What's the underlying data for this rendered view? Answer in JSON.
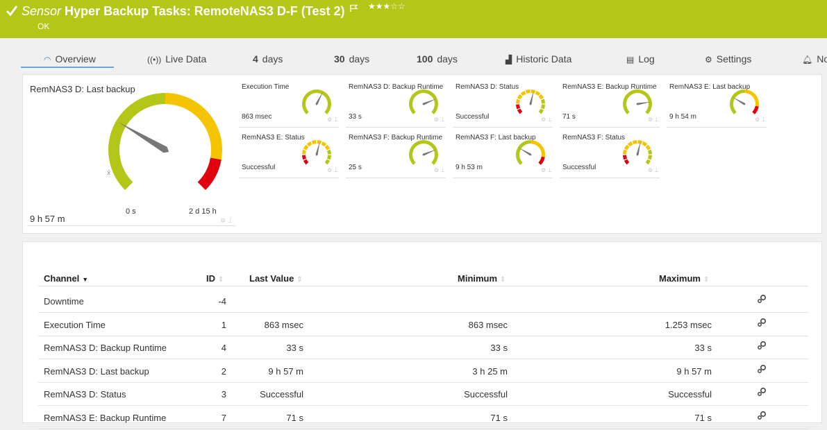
{
  "header": {
    "type_label": "Sensor",
    "title": "Hyper Backup Tasks: RemoteNAS3 D-F (Test 2)",
    "stars": "★★★☆☆",
    "status": "OK",
    "color": "#b4c618"
  },
  "tabs": [
    {
      "label": "Overview",
      "icon": "gauge-icon",
      "active": true
    },
    {
      "label": "Live Data",
      "icon": "live-signal-icon"
    },
    {
      "num": "4",
      "label": "days"
    },
    {
      "num": "30",
      "label": "days"
    },
    {
      "num": "100",
      "label": "days"
    },
    {
      "label": "Historic Data",
      "icon": "chart-icon"
    },
    {
      "label": "Log",
      "icon": "log-icon"
    },
    {
      "label": "Settings",
      "icon": "gear-icon"
    },
    {
      "label": "No",
      "icon": "bell-icon"
    }
  ],
  "main_gauge": {
    "title": "RemNAS3 D: Last backup",
    "value": "9 h 57 m",
    "min_label": "0 s",
    "max_label": "2 d 15 h",
    "needle_fraction": 0.28
  },
  "gauges": [
    {
      "name": "Execution Time",
      "value": "863 msec",
      "style": "green",
      "needle_fraction": 0.6
    },
    {
      "name": "RemNAS3 D: Backup Runtime",
      "value": "33 s",
      "style": "green",
      "needle_fraction": 0.75
    },
    {
      "name": "RemNAS3 D: Status",
      "value": "Successful",
      "style": "status",
      "needle_fraction": 0.55
    },
    {
      "name": "RemNAS3 E: Backup Runtime",
      "value": "71 s",
      "style": "green",
      "needle_fraction": 0.8
    },
    {
      "name": "RemNAS3 E: Last backup",
      "value": "9 h 54 m",
      "style": "timegauge",
      "needle_fraction": 0.28
    },
    {
      "name": "RemNAS3 E: Status",
      "value": "Successful",
      "style": "status",
      "needle_fraction": 0.55
    },
    {
      "name": "RemNAS3 F: Backup Runtime",
      "value": "25 s",
      "style": "green",
      "needle_fraction": 0.75
    },
    {
      "name": "RemNAS3 F: Last backup",
      "value": "9 h 53 m",
      "style": "timegauge",
      "needle_fraction": 0.28
    },
    {
      "name": "RemNAS3 F: Status",
      "value": "Successful",
      "style": "status",
      "needle_fraction": 0.55
    }
  ],
  "table": {
    "headers": {
      "channel": "Channel",
      "id": "ID",
      "last": "Last Value",
      "min": "Minimum",
      "max": "Maximum"
    },
    "rows": [
      {
        "channel": "Downtime",
        "id": "-4",
        "last": "",
        "min": "",
        "max": ""
      },
      {
        "channel": "Execution Time",
        "id": "1",
        "last": "863 msec",
        "min": "863 msec",
        "max": "1.253 msec"
      },
      {
        "channel": "RemNAS3 D: Backup Runtime",
        "id": "4",
        "last": "33 s",
        "min": "33 s",
        "max": "33 s"
      },
      {
        "channel": "RemNAS3 D: Last backup",
        "id": "2",
        "last": "9 h 57 m",
        "min": "3 h 25 m",
        "max": "9 h 57 m"
      },
      {
        "channel": "RemNAS3 D: Status",
        "id": "3",
        "last": "Successful",
        "min": "Successful",
        "max": "Successful"
      },
      {
        "channel": "RemNAS3 E: Backup Runtime",
        "id": "7",
        "last": "71 s",
        "min": "71 s",
        "max": "71 s"
      }
    ]
  },
  "colors": {
    "green": "#b4c618",
    "yellow": "#f5c400",
    "red": "#e0000e",
    "needle": "#777777"
  }
}
